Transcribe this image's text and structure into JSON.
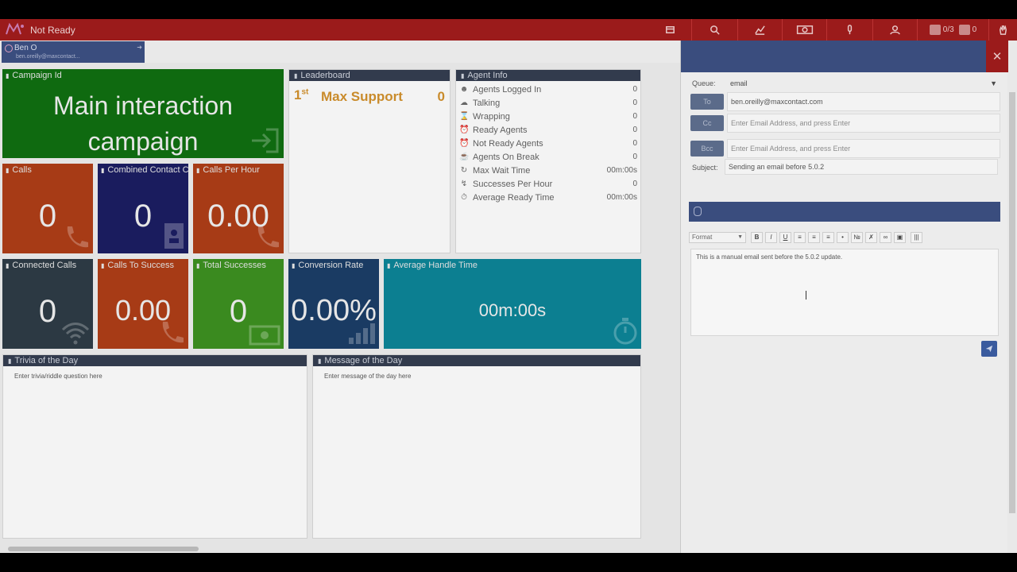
{
  "topbar": {
    "status": "Not Ready",
    "counter_agents": "0/3",
    "counter_other": "0",
    "colors": {
      "bar": "#9b1b1b",
      "accent": "#3a4d7e"
    }
  },
  "agent": {
    "name": "Ben O",
    "email": "ben.oreilly@maxcontact..."
  },
  "tiles": {
    "campaign": {
      "label": "Campaign Id",
      "value": "Main interaction campaign",
      "line1": "Main interaction",
      "line2": "campaign"
    },
    "calls": {
      "label": "Calls",
      "value": "0"
    },
    "combined": {
      "label": "Combined Contact C",
      "value": "0"
    },
    "calls_per_hour": {
      "label": "Calls Per Hour",
      "value": "0.00"
    },
    "connected": {
      "label": "Connected Calls",
      "value": "0"
    },
    "calls_to_success": {
      "label": "Calls To Success",
      "value": "0.00"
    },
    "total_successes": {
      "label": "Total Successes",
      "value": "0"
    },
    "conversion": {
      "label": "Conversion Rate",
      "value": "0.00%"
    },
    "aht": {
      "label": "Average Handle Time",
      "value": "00m:00s"
    }
  },
  "leaderboard": {
    "title": "Leaderboard",
    "rank": "1",
    "rank_suffix": "st",
    "name": "Max Support",
    "score": "0"
  },
  "agent_info": {
    "title": "Agent Info",
    "rows": [
      {
        "label": "Agents Logged In",
        "value": "0"
      },
      {
        "label": "Talking",
        "value": "0"
      },
      {
        "label": "Wrapping",
        "value": "0"
      },
      {
        "label": "Ready Agents",
        "value": "0"
      },
      {
        "label": "Not Ready Agents",
        "value": "0"
      },
      {
        "label": "Agents On Break",
        "value": "0"
      },
      {
        "label": "Max Wait Time",
        "value": "00m:00s"
      },
      {
        "label": "Successes Per Hour",
        "value": "0"
      },
      {
        "label": "Average Ready Time",
        "value": "00m:00s"
      }
    ]
  },
  "trivia": {
    "title": "Trivia of the Day",
    "text": "Enter trivia/riddle question here"
  },
  "message": {
    "title": "Message of the Day",
    "text": "Enter message of the day here"
  },
  "email": {
    "queue_label": "Queue:",
    "queue_value": "email",
    "to_label": "To",
    "to_value": "ben.oreilly@maxcontact.com",
    "cc_label": "Cc",
    "cc_placeholder": "Enter Email Address, and press Enter",
    "bcc_label": "Bcc",
    "bcc_placeholder": "Enter Email Address, and press Enter",
    "subject_label": "Subject:",
    "subject_value": "Sending an email before 5.0.2",
    "format_label": "Format",
    "body": "This is a manual email sent before the 5.0.2 update."
  }
}
